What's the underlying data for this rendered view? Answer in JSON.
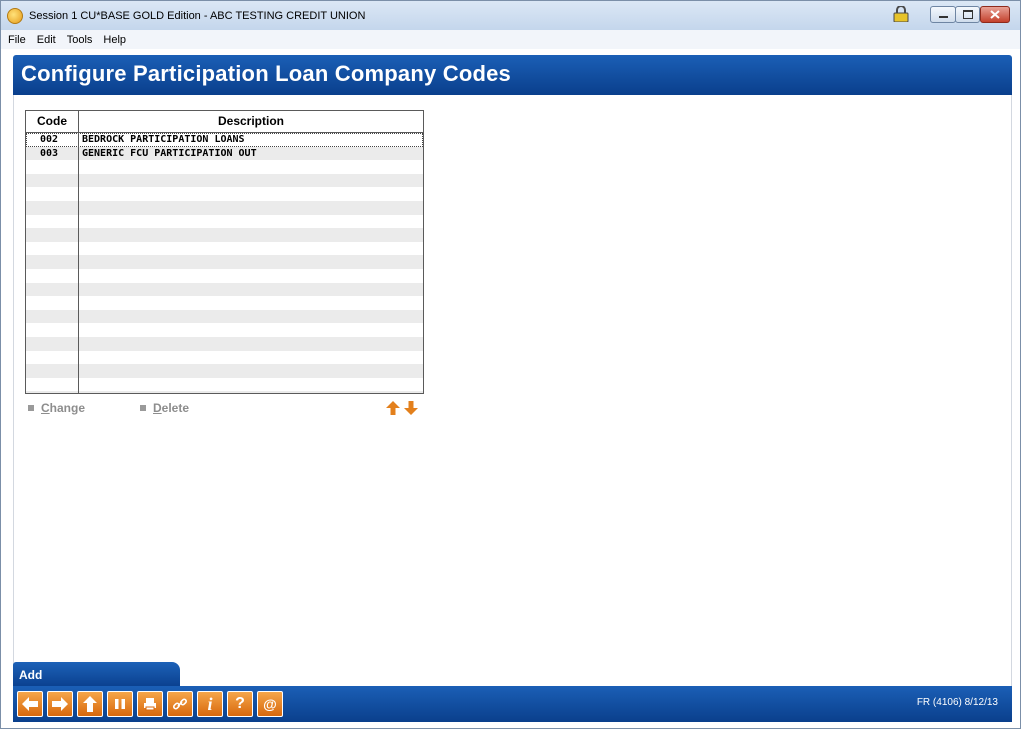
{
  "window": {
    "title": "Session 1 CU*BASE GOLD Edition - ABC TESTING CREDIT UNION"
  },
  "menu": [
    "File",
    "Edit",
    "Tools",
    "Help"
  ],
  "page_title": "Configure Participation Loan Company Codes",
  "table": {
    "headers": {
      "code": "Code",
      "description": "Description"
    },
    "rows": [
      {
        "code": "002",
        "description": "BEDROCK PARTICIPATION LOANS"
      },
      {
        "code": "003",
        "description": "GENERIC FCU PARTICIPATION OUT"
      }
    ]
  },
  "actions": {
    "change": {
      "first": "C",
      "rest": "hange"
    },
    "delete": {
      "first": "D",
      "rest": "elete"
    }
  },
  "tab": {
    "add": "Add"
  },
  "footer": {
    "code": "FR (4106) 8/12/13",
    "buttons": [
      {
        "name": "back-icon",
        "glyph": "←"
      },
      {
        "name": "forward-icon",
        "glyph": "→"
      },
      {
        "name": "up-icon",
        "glyph": "↑"
      },
      {
        "name": "pause-icon",
        "glyph": "❚❚"
      },
      {
        "name": "print-icon",
        "glyph": "▤"
      },
      {
        "name": "link-icon",
        "glyph": "∞"
      },
      {
        "name": "info-icon",
        "glyph": "i"
      },
      {
        "name": "help-icon",
        "glyph": "?"
      },
      {
        "name": "email-icon",
        "glyph": "@"
      }
    ]
  },
  "colors": {
    "header_blue": "#0f4ea3",
    "button_orange": "#e8821f"
  }
}
